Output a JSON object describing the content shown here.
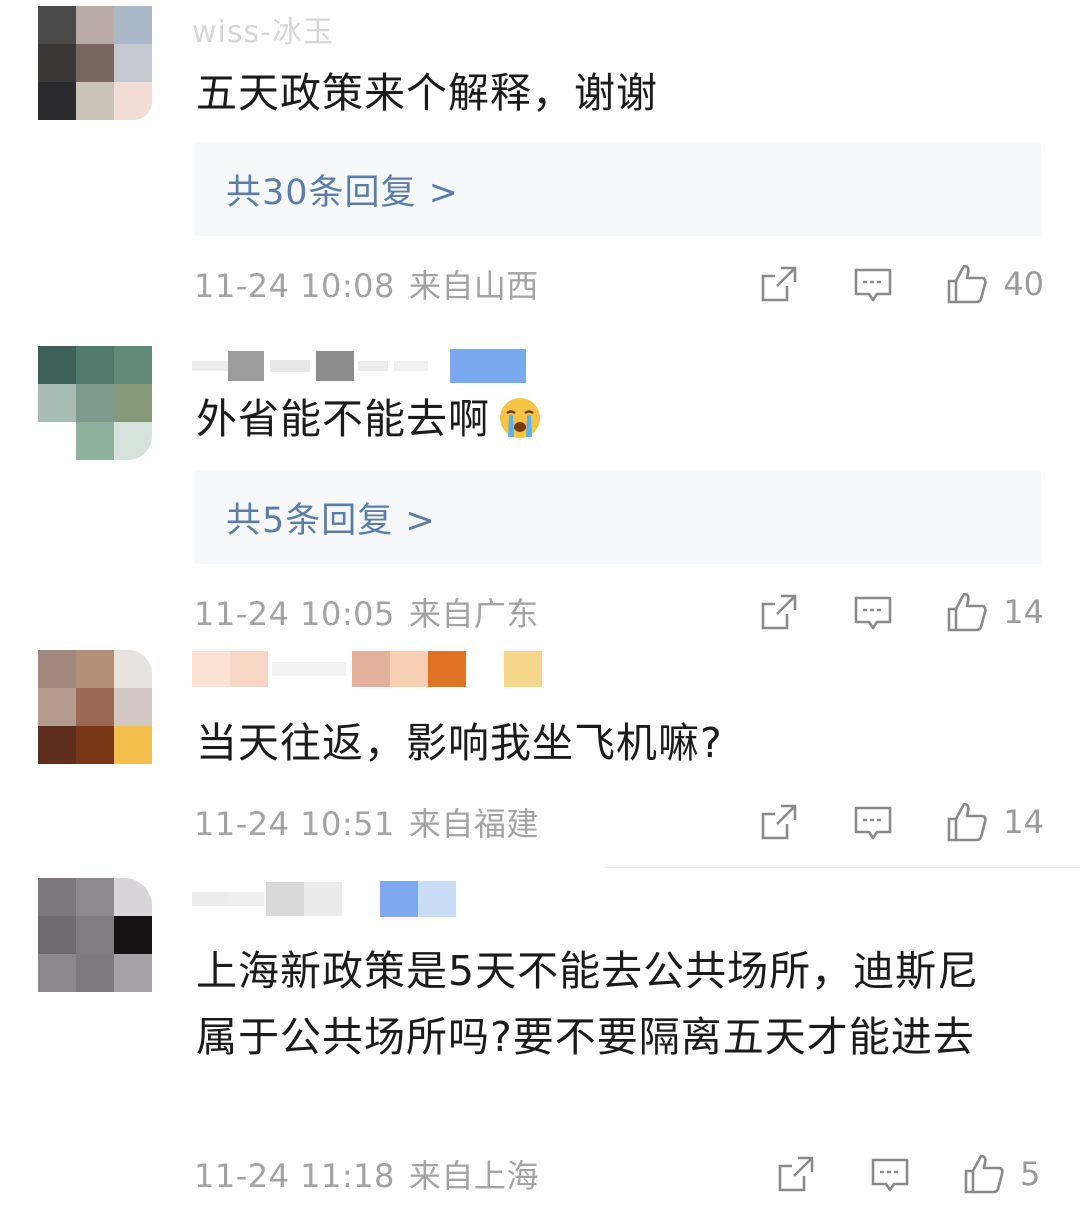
{
  "comments": [
    {
      "username": "wiss-冰玉",
      "content": "五天政策来个解释，谢谢",
      "reply_label": "共30条回复 >",
      "date": "11-24 10:08",
      "location": "来自山西",
      "likes": "40"
    },
    {
      "username": "",
      "content": "外省能不能去啊",
      "emoji": "crying-face-emoji",
      "reply_label": "共5条回复 >",
      "date": "11-24 10:05",
      "location": "来自广东",
      "likes": "14"
    },
    {
      "username": "",
      "content": "当天往返，影响我坐飞机嘛?",
      "date": "11-24 10:51",
      "location": "来自福建",
      "likes": "14"
    },
    {
      "username": "",
      "content": "上海新政策是5天不能去公共场所，迪斯尼属于公共场所吗?要不要隔离五天才能进去",
      "date": "11-24 11:18",
      "location": "来自上海",
      "likes": "5"
    }
  ],
  "icons": {
    "share": "share-icon",
    "comment": "comment-icon",
    "like": "thumbs-up-icon"
  },
  "colors": {
    "reply_link": "#5b7ea8",
    "meta_text": "#a3a3a3",
    "reply_bg": "#f6f7f9"
  }
}
